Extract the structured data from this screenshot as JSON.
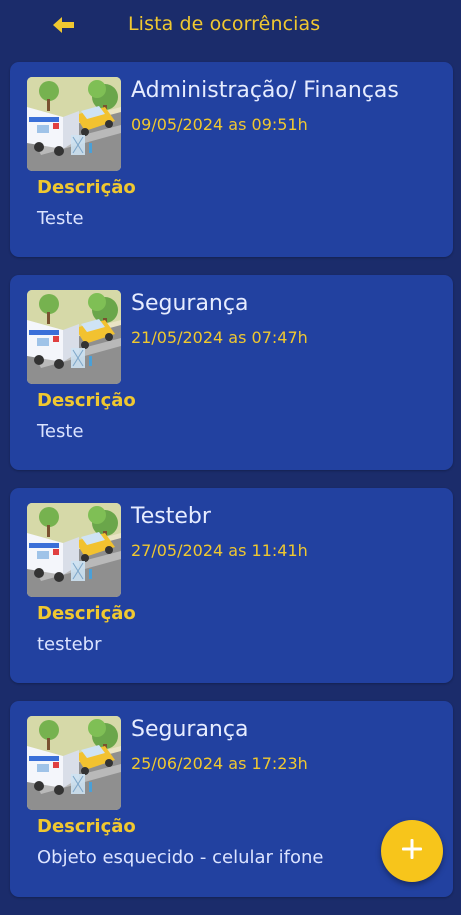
{
  "header": {
    "back_icon": "arrow-left-icon",
    "title": "Lista de ocorrências"
  },
  "colors": {
    "background": "#1b2c6b",
    "card": "#2241a0",
    "accent": "#f0c830",
    "fab": "#f7c51b"
  },
  "occurrences": [
    {
      "title": "Administração/ Finanças",
      "date": "09/05/2024 as 09:51h",
      "desc_label": "Descrição",
      "description": "Teste"
    },
    {
      "title": "Segurança",
      "date": "21/05/2024 as 07:47h",
      "desc_label": "Descrição",
      "description": "Teste"
    },
    {
      "title": "Testebr",
      "date": "27/05/2024 as 11:41h",
      "desc_label": "Descrição",
      "description": "testebr"
    },
    {
      "title": "Segurança",
      "date": "25/06/2024 as 17:23h",
      "desc_label": "Descrição",
      "description": "Objeto esquecido - celular ifone"
    }
  ],
  "fab": {
    "icon": "plus-icon"
  }
}
